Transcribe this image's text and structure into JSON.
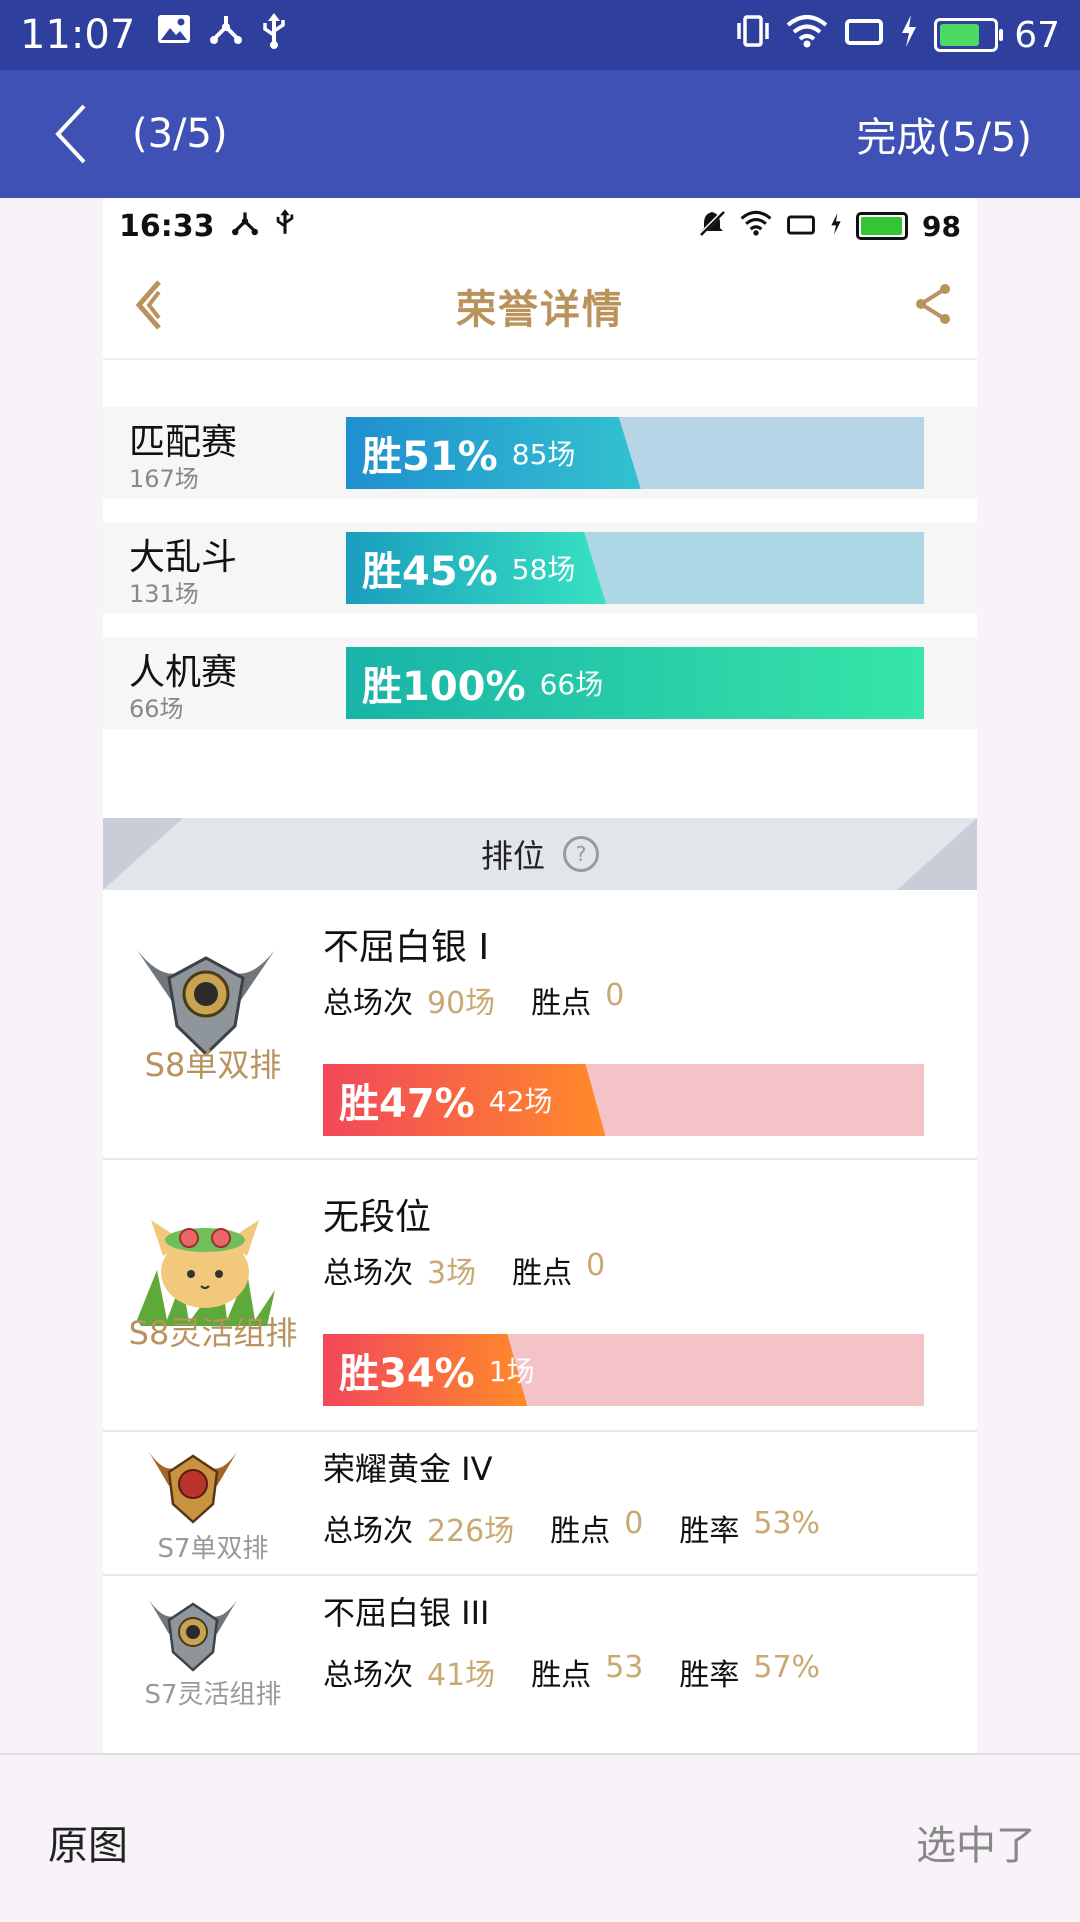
{
  "status_bar": {
    "time": "11:07",
    "battery": "67"
  },
  "app_bar": {
    "counter": "(3/5)",
    "done": "完成(5/5)"
  },
  "inner_screen": {
    "status_bar": {
      "time": "16:33",
      "battery": "98"
    },
    "title": "荣誉详情",
    "modes": [
      {
        "name": "匹配赛",
        "total": "167场",
        "win_label": "胜51%",
        "win_games": "85场",
        "win_fraction": 0.51
      },
      {
        "name": "大乱斗",
        "total": "131场",
        "win_label": "胜45%",
        "win_games": "58场",
        "win_fraction": 0.45
      },
      {
        "name": "人机赛",
        "total": "66场",
        "win_label": "胜100%",
        "win_games": "66场",
        "win_fraction": 1.0
      }
    ],
    "ranked_header": "排位",
    "seasons": [
      {
        "label": "S8单双排",
        "tier": "不屈白银 I",
        "games_label": "总场次",
        "games": "90场",
        "points_label": "胜点",
        "points": "0",
        "win_label": "胜47%",
        "win_games": "42场",
        "win_fraction": 0.47
      },
      {
        "label": "S8灵活组排",
        "tier": "无段位",
        "games_label": "总场次",
        "games": "3场",
        "points_label": "胜点",
        "points": "0",
        "win_label": "胜34%",
        "win_games": "1场",
        "win_fraction": 0.34
      },
      {
        "label": "S7单双排",
        "tier": "荣耀黄金 IV",
        "games_label": "总场次",
        "games": "226场",
        "points_label": "胜点",
        "points": "0",
        "rate_label": "胜率",
        "rate": "53%"
      },
      {
        "label": "S7灵活组排",
        "tier": "不屈白银 III",
        "games_label": "总场次",
        "games": "41场",
        "points_label": "胜点",
        "points": "53",
        "rate_label": "胜率",
        "rate": "57%"
      }
    ]
  },
  "bottom_bar": {
    "original": "原图",
    "selected": "选中了"
  },
  "colors": {
    "status_bar": "#2f3f9d",
    "app_bar": "#3f51b5",
    "gold": "#b9925c"
  }
}
